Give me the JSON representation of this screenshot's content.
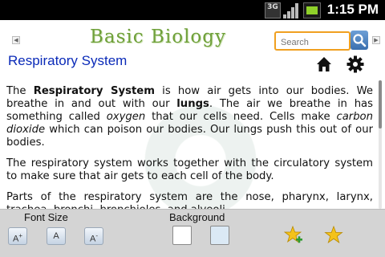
{
  "status_bar": {
    "network_label": "3G",
    "time": "1:15 PM",
    "icons": [
      "3g-icon",
      "signal-icon",
      "battery-icon"
    ]
  },
  "header": {
    "app_title": "Basic Biology",
    "search_placeholder": "Search",
    "page_title": "Respiratory System",
    "icons": [
      "home-icon",
      "gear-icon",
      "search-icon",
      "arrow-left-icon",
      "arrow-right-icon"
    ]
  },
  "article": {
    "p1": {
      "s1": "The ",
      "b1": "Respiratory System",
      "s2": " is how air gets into our bodies. We breathe in and out with our ",
      "b2": "lungs",
      "s3": ". The air we breathe in has something called ",
      "i1": "oxygen",
      "s4": " that our cells need. Cells make ",
      "i2": "carbon dioxide",
      "s5": " which can poison our bodies. Our lungs push this out of our bodies."
    },
    "p2": "The respiratory system works together with the circulatory system to make sure that air gets to each cell of the body.",
    "p3": "Parts of the respiratory system are the nose, pharynx, larynx, trachea, bronchi, bronchioles, and alveoli."
  },
  "toolbar": {
    "font_size_label": "Font Size",
    "font_increase": "A",
    "font_increase_sup": "+",
    "font_normal": "A",
    "font_decrease": "A",
    "font_decrease_sup": "-",
    "background_label": "Background",
    "bg_colors": [
      "#ffffff",
      "#dbe9f5"
    ],
    "icons": [
      "add-favorite-icon",
      "favorite-star-icon"
    ]
  },
  "colors": {
    "title_blue": "#0a2ab8",
    "logo_green": "#6fa03a",
    "search_border": "#f0a020",
    "toolbar_bg": "#d4d4d4"
  }
}
